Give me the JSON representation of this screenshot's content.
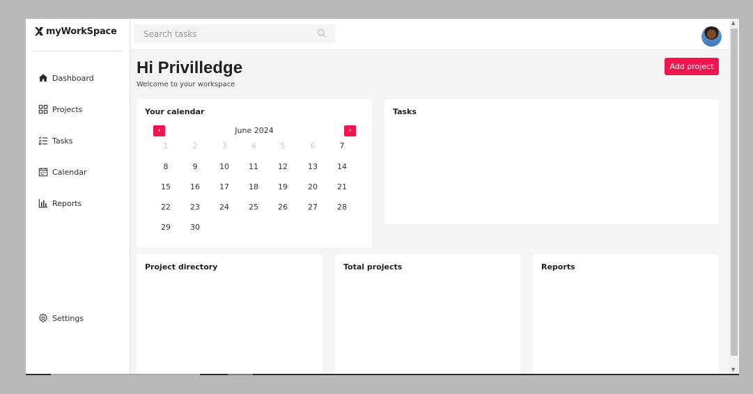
{
  "app": {
    "name": "myWorkSpace"
  },
  "sidebar": {
    "items": [
      {
        "label": "Dashboard",
        "icon": "home-icon"
      },
      {
        "label": "Projects",
        "icon": "grid-icon"
      },
      {
        "label": "Tasks",
        "icon": "checklist-icon"
      },
      {
        "label": "Calendar",
        "icon": "calendar-icon"
      },
      {
        "label": "Reports",
        "icon": "bar-chart-icon"
      }
    ],
    "settings": {
      "label": "Settings",
      "icon": "gear-icon"
    }
  },
  "search": {
    "placeholder": "Search tasks",
    "icon": "search-icon"
  },
  "user": {
    "avatar": "user-avatar"
  },
  "header": {
    "greeting": "Hi Privilledge",
    "subtitle": "Welcome to your workspace",
    "add_button": "Add project"
  },
  "calendar": {
    "title": "Your calendar",
    "month": "June 2024",
    "prev_icon": "chevron-left-icon",
    "next_icon": "chevron-right-icon",
    "weeks": [
      [
        "1",
        "2",
        "3",
        "4",
        "5",
        "6",
        "7"
      ],
      [
        "8",
        "9",
        "10",
        "11",
        "12",
        "13",
        "14"
      ],
      [
        "15",
        "16",
        "17",
        "18",
        "19",
        "20",
        "21"
      ],
      [
        "22",
        "23",
        "24",
        "25",
        "26",
        "27",
        "28"
      ],
      [
        "29",
        "30"
      ]
    ]
  },
  "cards": {
    "tasks": "Tasks",
    "project_directory": "Project directory",
    "total_projects": "Total projects",
    "reports": "Reports"
  },
  "colors": {
    "accent": "#f0144f",
    "background": "#f5f5f5",
    "card": "#ffffff"
  }
}
